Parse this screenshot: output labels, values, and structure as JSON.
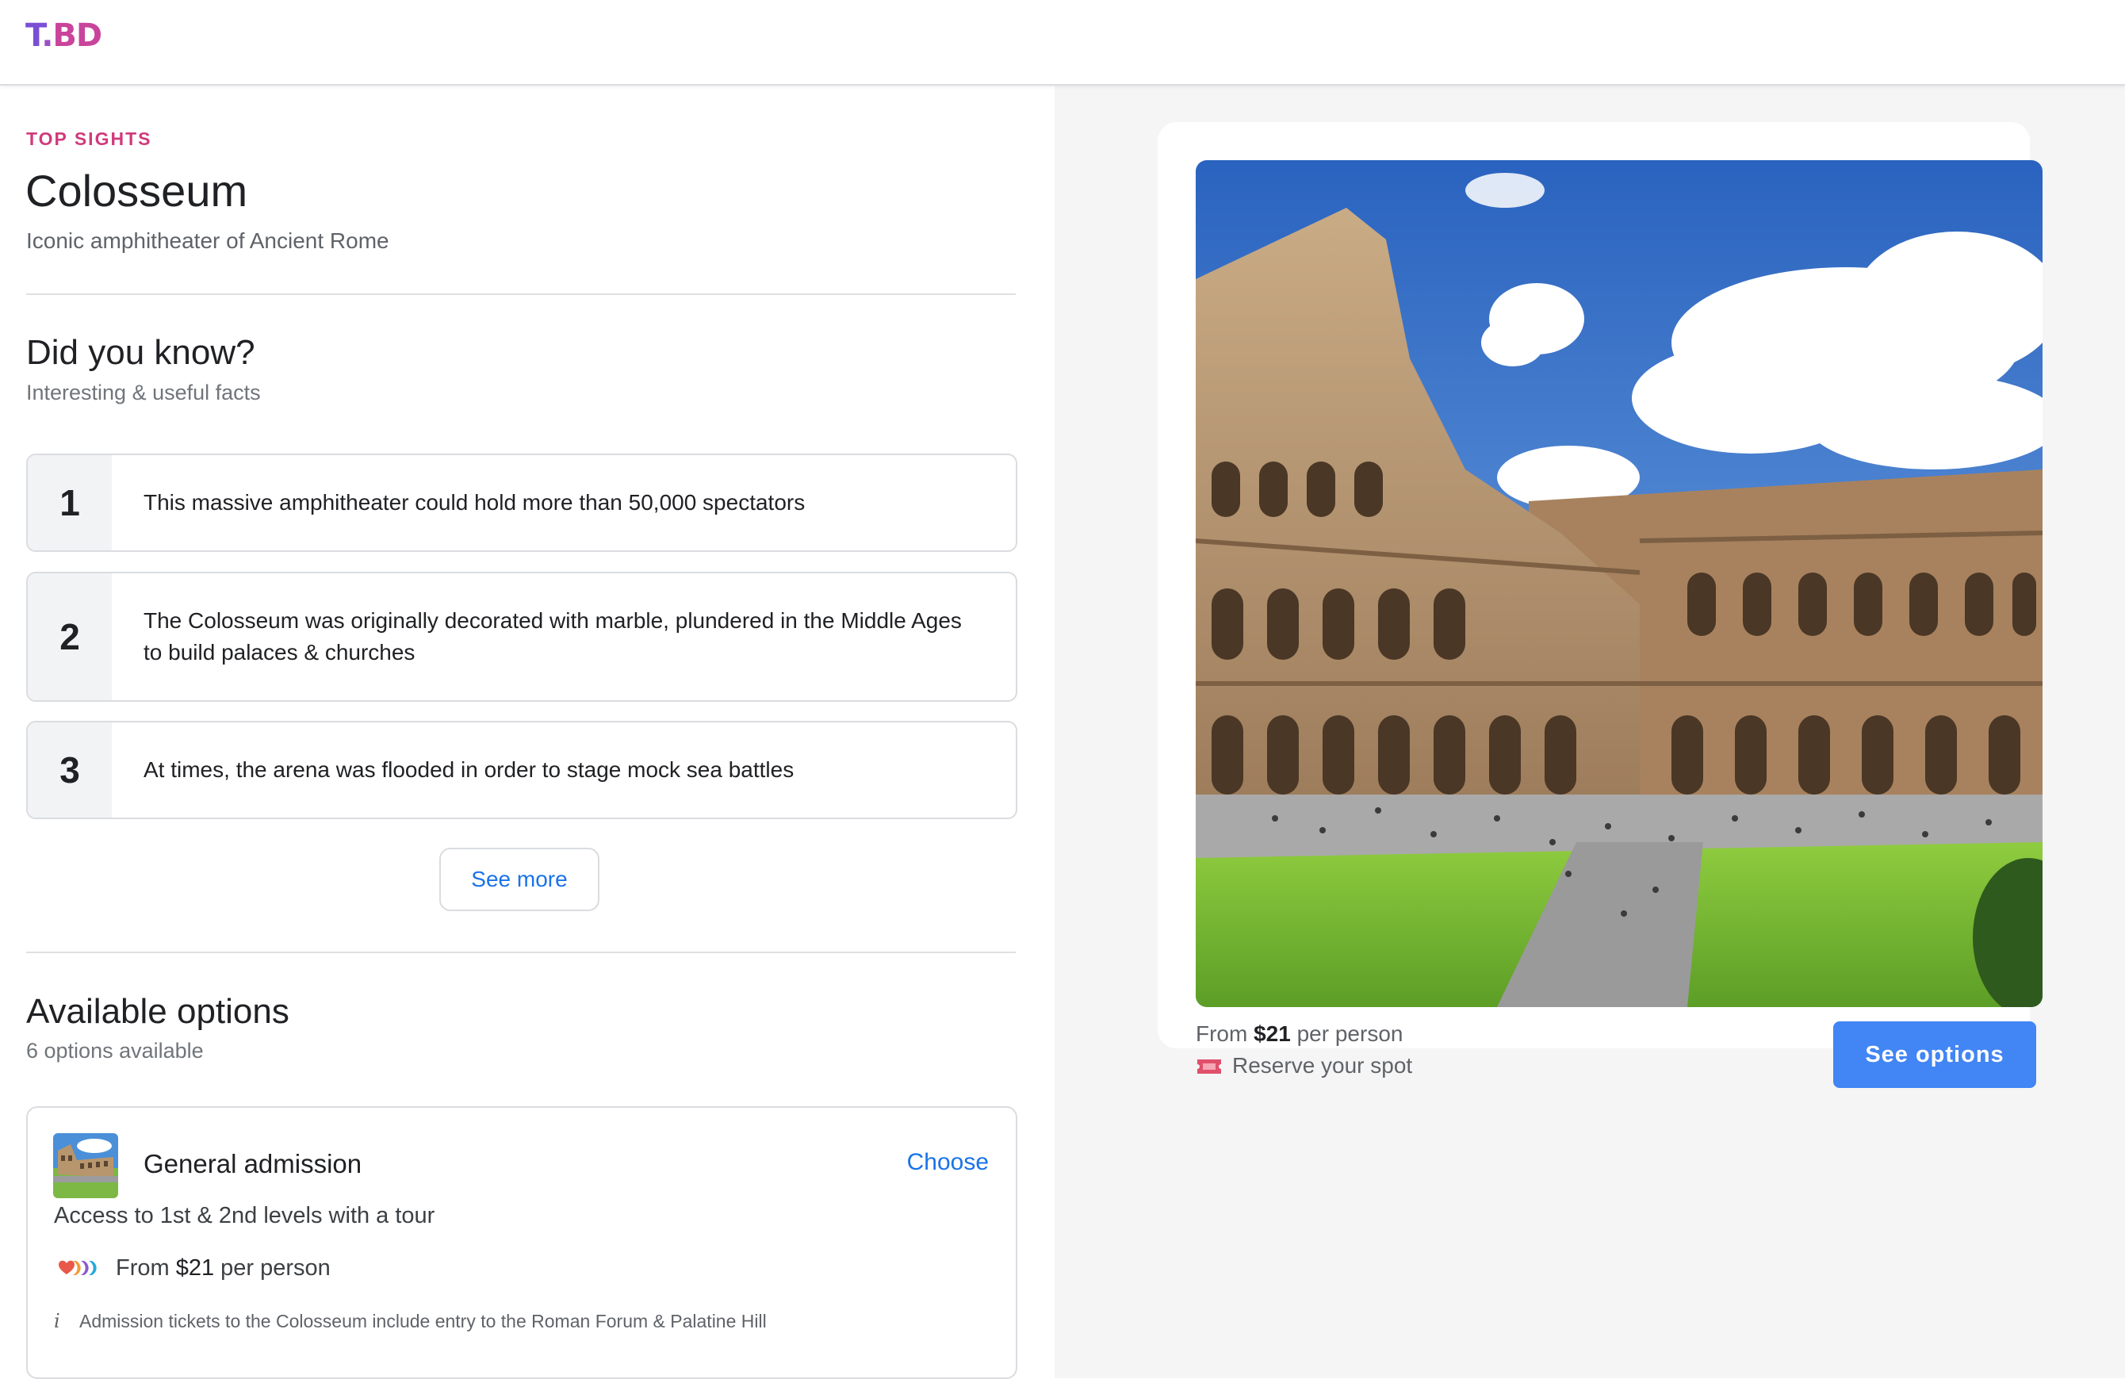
{
  "app": {
    "logo": {
      "part1": "T",
      "part2": ".",
      "part3": "BD"
    }
  },
  "sight": {
    "eyebrow": "TOP SIGHTS",
    "title": "Colosseum",
    "subtitle": "Iconic amphitheater of Ancient Rome"
  },
  "facts": {
    "heading": "Did you know?",
    "subheading": "Interesting & useful facts",
    "items": [
      {
        "num": "1",
        "text": "This massive amphitheater could hold more than 50,000 spectators"
      },
      {
        "num": "2",
        "text": "The Colosseum was originally decorated with marble, plundered in the Middle Ages to build palaces & churches"
      },
      {
        "num": "3",
        "text": "At times, the arena was flooded in order to stage mock sea battles"
      }
    ],
    "see_more_label": "See more"
  },
  "options": {
    "heading": "Available options",
    "subheading": "6 options available",
    "items": [
      {
        "title": "General admission",
        "choose_label": "Choose",
        "description": "Access to 1st & 2nd levels with a tour",
        "price_prefix": "From ",
        "price": "$21",
        "price_suffix": " per person",
        "info_icon": "i",
        "info": "Admission tickets to the Colosseum include entry to the Roman Forum & Palatine Hill"
      }
    ]
  },
  "booking": {
    "price_prefix": "From ",
    "price": "$21",
    "price_suffix": " per person",
    "reserve_label": "Reserve your spot",
    "see_options_label": "See options"
  },
  "icons": {
    "ticket": "ticket-icon",
    "info": "info-icon",
    "provider_logos": "provider-logos-icon"
  },
  "colors": {
    "accent": "#d03a7c",
    "link": "#1a73e8",
    "primary_button": "#4285f4"
  }
}
